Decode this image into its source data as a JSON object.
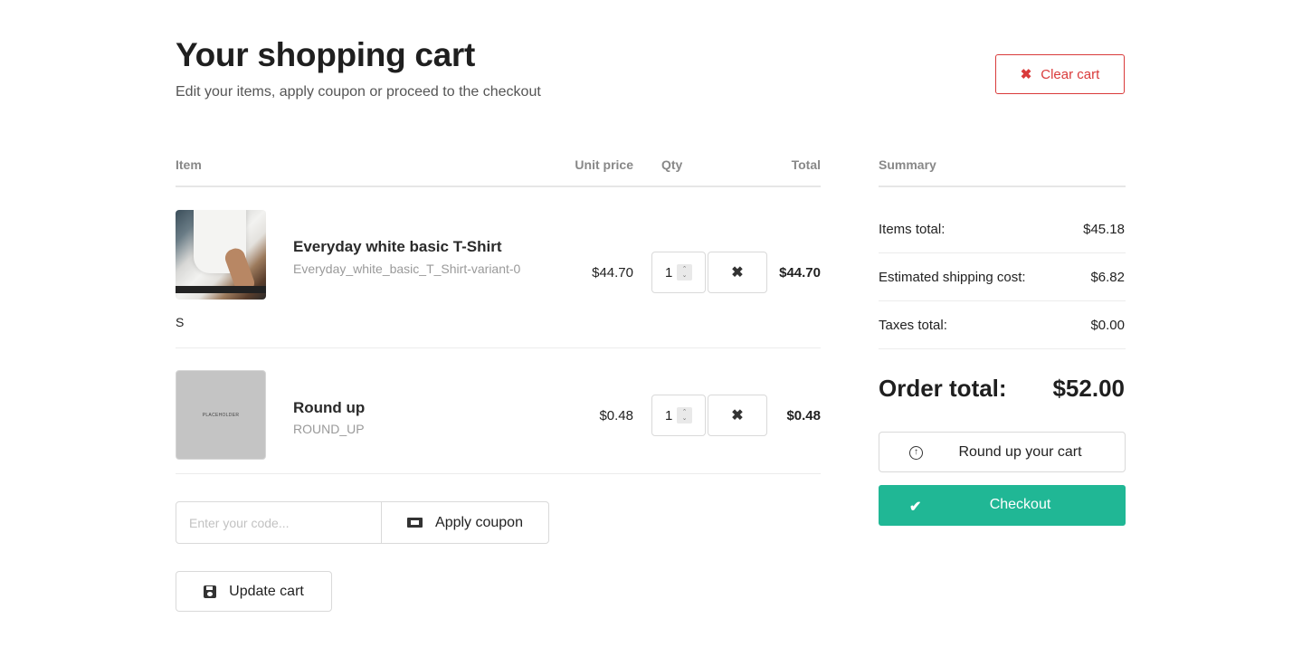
{
  "header": {
    "title": "Your shopping cart",
    "subtitle": "Edit your items, apply coupon or proceed to the checkout",
    "clear_label": "Clear cart",
    "clear_icon": "close-icon"
  },
  "table": {
    "headers": {
      "item": "Item",
      "unit_price": "Unit price",
      "qty": "Qty",
      "total": "Total"
    }
  },
  "items": [
    {
      "name": "Everyday white basic T-Shirt",
      "sku": "Everyday_white_basic_T_Shirt-variant-0",
      "variant": "S",
      "unit_price": "$44.70",
      "qty": "1",
      "total": "$44.70",
      "image": "product-photo"
    },
    {
      "name": "Round up",
      "sku": "ROUND_UP",
      "unit_price": "$0.48",
      "qty": "1",
      "total": "$0.48",
      "image_text": "PLACEHOLDER"
    }
  ],
  "coupon": {
    "placeholder": "Enter your code...",
    "apply_label": "Apply coupon"
  },
  "update_label": "Update cart",
  "summary": {
    "heading": "Summary",
    "rows": [
      {
        "label": "Items total:",
        "value": "$45.18"
      },
      {
        "label": "Estimated shipping cost:",
        "value": "$6.82"
      },
      {
        "label": "Taxes total:",
        "value": "$0.00"
      }
    ],
    "order_total_label": "Order total:",
    "order_total_value": "$52.00",
    "roundup_label": "Round up your cart",
    "checkout_label": "Checkout"
  },
  "colors": {
    "accent": "#20b795",
    "danger": "#d93a3a"
  }
}
